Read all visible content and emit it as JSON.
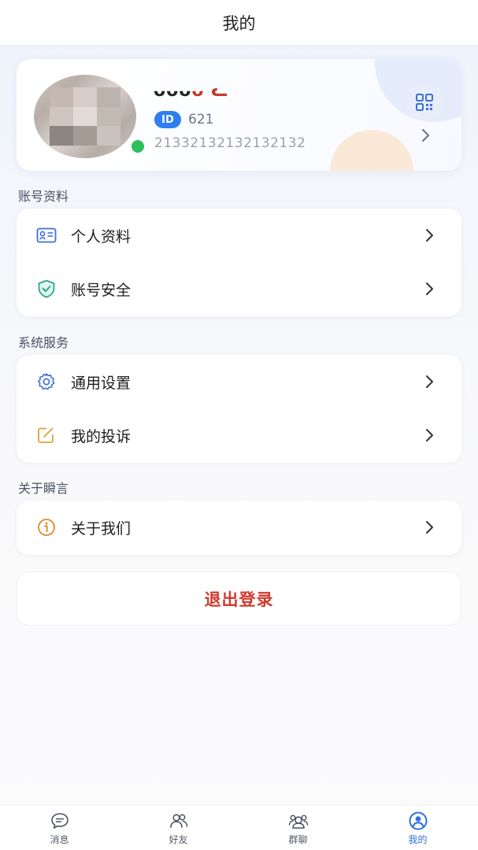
{
  "header": {
    "title": "我的"
  },
  "profile": {
    "nickname": "ᴗᴗᴗ",
    "nickname_tail": "ᴗ ᓚ",
    "id_badge": "ID",
    "id_value": "621",
    "phone": "21332132132132132",
    "qr_icon": "qr-code-icon",
    "online_color": "#2fbf5a"
  },
  "sections": {
    "account": {
      "title": "账号资料",
      "items": [
        {
          "label": "个人资料",
          "icon": "id-card-icon"
        },
        {
          "label": "账号安全",
          "icon": "shield-check-icon"
        }
      ]
    },
    "system": {
      "title": "系统服务",
      "items": [
        {
          "label": "通用设置",
          "icon": "gear-icon"
        },
        {
          "label": "我的投诉",
          "icon": "edit-icon"
        }
      ]
    },
    "about": {
      "title": "关于瞬言",
      "items": [
        {
          "label": "关于我们",
          "icon": "info-icon"
        }
      ]
    }
  },
  "logout": {
    "label": "退出登录",
    "color": "#cf3a2e"
  },
  "tabbar": {
    "tabs": [
      {
        "label": "消息",
        "icon": "chat-bubble-icon"
      },
      {
        "label": "好友",
        "icon": "friends-icon"
      },
      {
        "label": "群聊",
        "icon": "group-chat-icon"
      },
      {
        "label": "我的",
        "icon": "profile-icon"
      }
    ],
    "active_index": 3,
    "accent": "#2f6fe0"
  }
}
